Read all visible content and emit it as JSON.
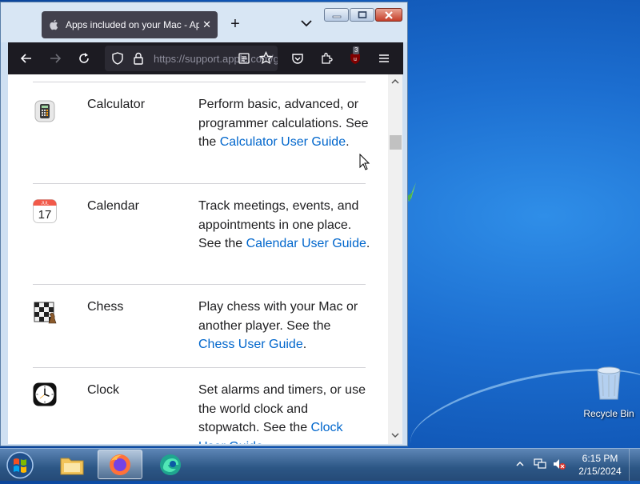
{
  "browser": {
    "tab_title": "Apps included on your Mac - Apple Support",
    "url": "https://support.apple.com/guide/mac-help/apps-included-with-your-mac",
    "ublock_count": "3"
  },
  "apps": [
    {
      "name": "Calculator",
      "desc_before": "Perform basic, advanced, or programmer calculations. See the ",
      "link": "Calculator User Guide",
      "desc_after": "."
    },
    {
      "name": "Calendar",
      "desc_before": "Track meetings, events, and appointments in one place. See the ",
      "link": "Calendar User Guide",
      "desc_after": ".",
      "icon_month": "JUL",
      "icon_day": "17"
    },
    {
      "name": "Chess",
      "desc_before": "Play chess with your Mac or another player. See the ",
      "link": "Chess User Guide",
      "desc_after": "."
    },
    {
      "name": "Clock",
      "desc_before": "Set alarms and timers, or use the world clock and stopwatch. See the ",
      "link": "Clock User Guide",
      "desc_after": "."
    }
  ],
  "desktop": {
    "recycle_bin_label": "Recycle Bin"
  },
  "taskbar": {
    "time": "6:15 PM",
    "date": "2/15/2024"
  },
  "colors": {
    "link": "#0066cc",
    "browser_chrome": "#1c1b22",
    "desktop": "#1c6ed0"
  }
}
